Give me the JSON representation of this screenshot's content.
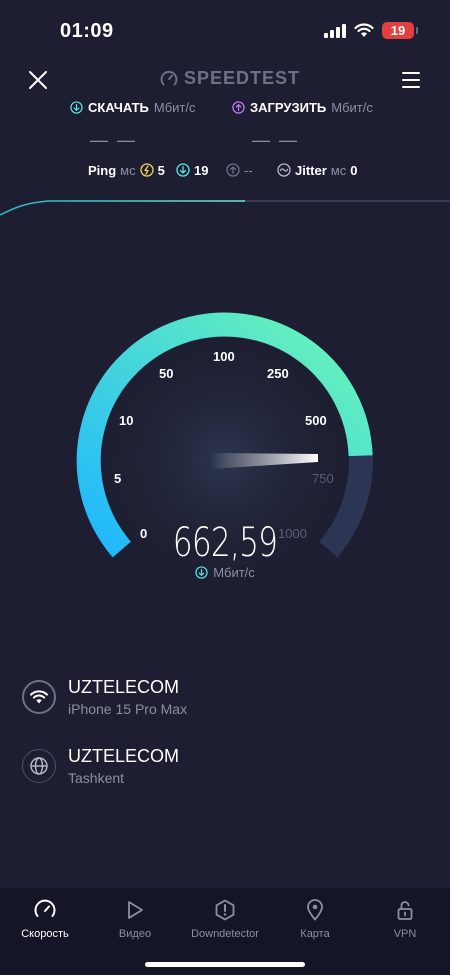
{
  "status": {
    "time": "01:09",
    "battery": "19"
  },
  "header": {
    "logo": "SPEEDTEST"
  },
  "download": {
    "label": "СКАЧАТЬ",
    "unit": "Мбит/с",
    "value": "— —"
  },
  "upload": {
    "label": "ЗАГРУЗИТЬ",
    "unit": "Мбит/с",
    "value": "— —"
  },
  "ping": {
    "label": "Ping",
    "unit": "мс",
    "idle": "5",
    "download": "19",
    "upload": "--",
    "jitter_label": "Jitter",
    "jitter_unit": "мс",
    "jitter": "0"
  },
  "gauge": {
    "ticks": [
      "0",
      "5",
      "10",
      "50",
      "100",
      "250",
      "500",
      "750",
      "1000"
    ],
    "value": "662,59",
    "unit": "Мбит/с",
    "colors": {
      "start": "#1fb6ff",
      "end": "#6cf7b5",
      "track": "#2c3553"
    }
  },
  "connections": [
    {
      "title": "UZTELECOM",
      "subtitle": "iPhone 15 Pro Max",
      "icon": "wifi-icon"
    },
    {
      "title": "UZTELECOM",
      "subtitle": "Tashkent",
      "icon": "globe-icon"
    }
  ],
  "tabs": [
    {
      "label": "Скорость",
      "icon": "gauge-icon",
      "active": true
    },
    {
      "label": "Видео",
      "icon": "play-icon"
    },
    {
      "label": "Downdetector",
      "icon": "alert-icon"
    },
    {
      "label": "Карта",
      "icon": "map-pin-icon"
    },
    {
      "label": "VPN",
      "icon": "lock-icon"
    }
  ]
}
